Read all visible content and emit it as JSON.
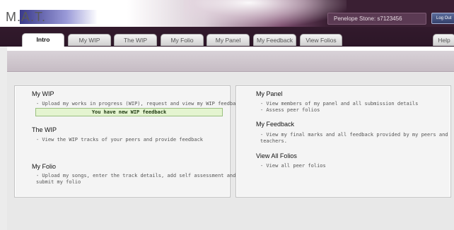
{
  "header": {
    "logo": "M.A.T.",
    "user": "Penelope Stone: s7123456",
    "logout_label": "Log Out",
    "colors": {
      "header_bg": "#2c1627",
      "subbar": "#c6bcc4",
      "notice_bg": "#e4f4d0"
    }
  },
  "tabs": [
    {
      "label": "Intro",
      "active": true
    },
    {
      "label": "My WIP"
    },
    {
      "label": "The WIP"
    },
    {
      "label": "My Folio"
    },
    {
      "label": "My Panel"
    },
    {
      "label": "My Feedback"
    },
    {
      "label": "View Folios"
    },
    {
      "label": "Help"
    }
  ],
  "left_panel": {
    "my_wip": {
      "title": "My WIP",
      "desc": "- Upload my works in progress (WIP), request and view my WIP feedback",
      "notice": "You have new WIP feedback"
    },
    "the_wip": {
      "title": "The WIP",
      "desc": "- View the WIP tracks of your peers and provide feedback"
    },
    "my_folio": {
      "title": "My Folio",
      "desc_line1": "- Upload my songs, enter the track details, add self assessment and",
      "desc_line2": "submit my folio"
    }
  },
  "right_panel": {
    "my_panel": {
      "title": "My Panel",
      "desc_line1": "- View members of my panel and all submission details",
      "desc_line2": "- Assess peer folios"
    },
    "my_feedback": {
      "title": "My Feedback",
      "desc_line1": "- View my final marks and all feedback provided by my peers and",
      "desc_line2": "teachers."
    },
    "view_all": {
      "title": "View All Folios",
      "desc": "- View all peer folios"
    }
  }
}
